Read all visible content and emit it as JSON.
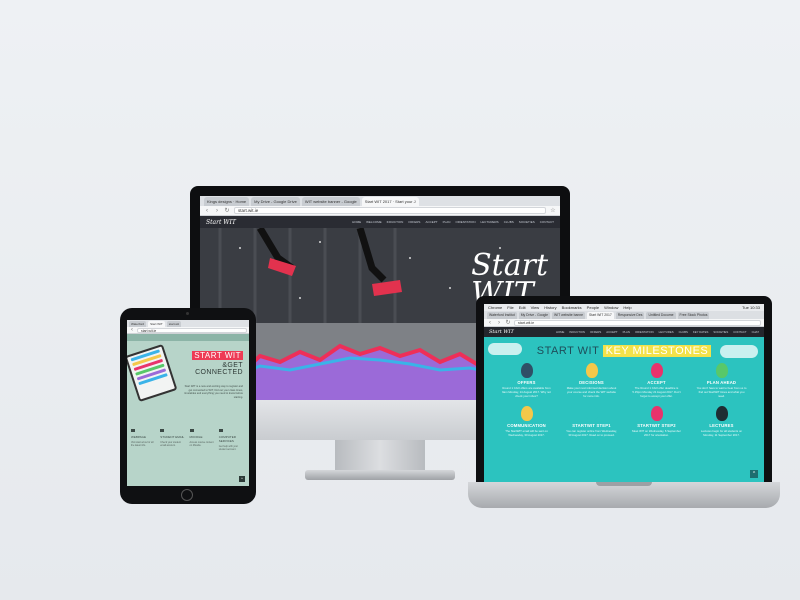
{
  "imac": {
    "tabs": [
      "Kings designs · Home",
      "My Drive - Google Drive",
      "WIT website banner - Google",
      "Start WIT 2017 · Start your J"
    ],
    "url": "start.wit.ie",
    "site": {
      "logo": "Start WIT",
      "nav": [
        "Home",
        "Welcome",
        "Induction",
        "Offers",
        "Accept",
        "Plan",
        "Orientation",
        "Lecturers",
        "Clubs",
        "Societies",
        "Contact"
      ]
    },
    "hero_title": [
      "Start",
      "WIT"
    ]
  },
  "laptop": {
    "menubar": [
      "Chrome",
      "File",
      "Edit",
      "View",
      "History",
      "Bookmarks",
      "People",
      "Window",
      "Help"
    ],
    "clock": "Tue 10:33",
    "tabs": [
      "Waterford Institut",
      "My Drive - Google",
      "WIT website banne",
      "Start WIT 2017",
      "Responsive Des",
      "Untitled Docume",
      "Free Stock Photos"
    ],
    "url": "start.wit.ie",
    "logo": "Start WIT",
    "nav": [
      "Home",
      "Induction",
      "Offers",
      "Accept",
      "Plan",
      "Orientation",
      "Lectures",
      "Clubs",
      "Key Dates",
      "Societies",
      "Contact",
      "Chat"
    ],
    "title_part1": "START WIT",
    "title_part2": "KEY MILESTONES",
    "milestones": [
      {
        "label": "OFFERS",
        "color": "#2f4f66",
        "text": "Round 1 CAO offers are available from 9am Monday, 14 August 2017. Why not check your inbox?"
      },
      {
        "label": "DECISIONS",
        "color": "#f4c84a",
        "text": "Make your next informed decision about your course and check the WIT website for more info."
      },
      {
        "label": "ACCEPT",
        "color": "#e8336c",
        "text": "The Round 1 CAO offer deadline is 5.15pm Monday 21 August 2017. Don't forget to accept your offer."
      },
      {
        "label": "PLAN AHEAD",
        "color": "#58c86a",
        "text": "You don't have to wait to hear from us to find out StartWIT times and what you need."
      },
      {
        "label": "COMMUNICATION",
        "color": "#f4c84a",
        "text": "The StartWIT email will be sent on Wednesday, 30 August 2017."
      },
      {
        "label": "STARTWIT STEP1",
        "color": "#2cc3bf",
        "text": "You can register online from Wednesday, 30 August 2017. Read on to proceed."
      },
      {
        "label": "STARTWIT STEP2",
        "color": "#e8336c",
        "text": "Meet WIT on Wednesday, 6 September 2017 for orientation."
      },
      {
        "label": "LECTURES",
        "color": "#1e2d33",
        "text": "Lectures begin for all students on Monday, 11 September 2017."
      }
    ],
    "to_top": "^"
  },
  "tablet": {
    "tabs": [
      "Waterford",
      "Start WIT",
      "start.wit"
    ],
    "url": "start.wit.ie",
    "highlight": "START WIT",
    "sub_line1": "&GET",
    "sub_line2": "CONNECTED",
    "body": "Start WIT is a new and exciting way to register and get connected to WIT, find out your class times, timetables and everything you need to know before starting.",
    "columns": [
      {
        "title": "WEBPAGE",
        "text": "Visit start.wit.ie for all the latest info."
      },
      {
        "title": "STUDENT EMAIL",
        "text": "Check your student email account."
      },
      {
        "title": "MOODLE",
        "text": "Access course content on Moodle."
      },
      {
        "title": "COMPUTER SERVICES",
        "text": "Get help with your student account."
      }
    ],
    "to_top": "^"
  }
}
